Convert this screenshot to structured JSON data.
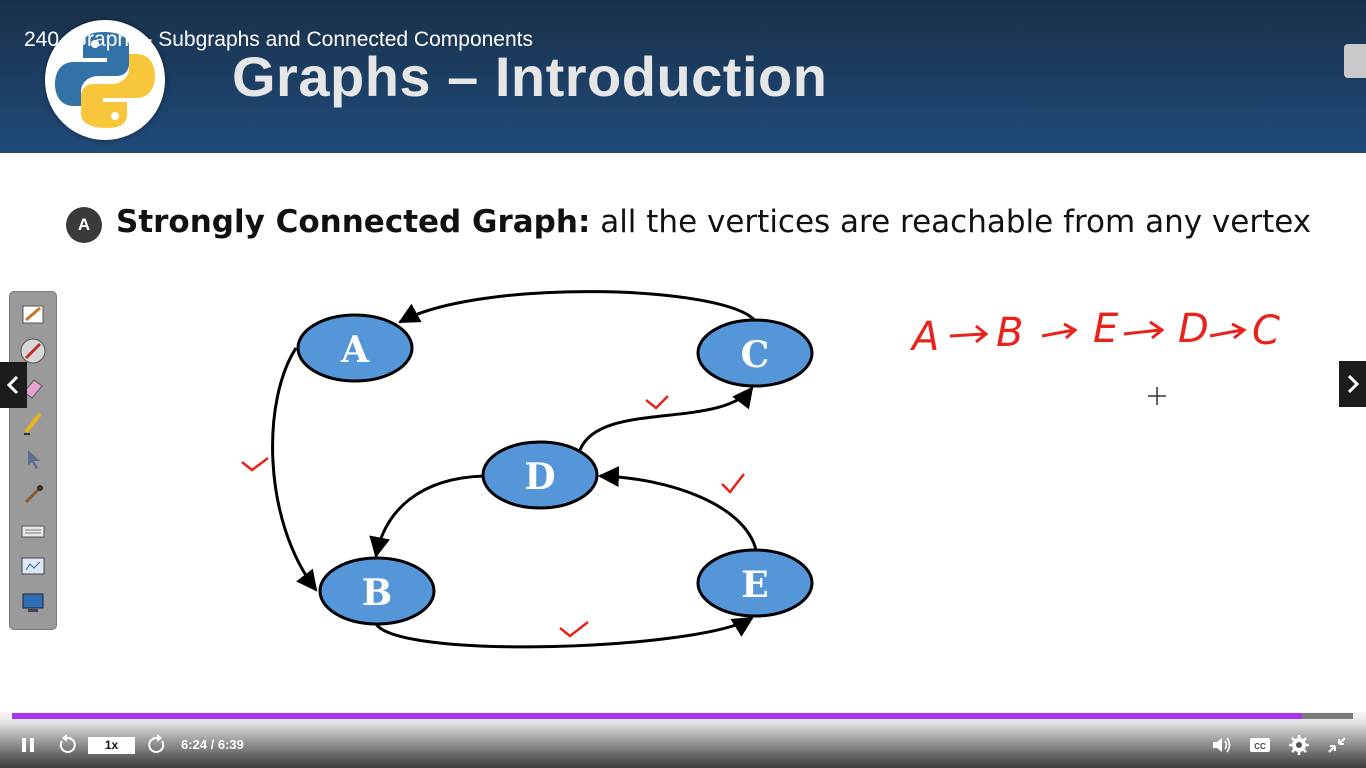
{
  "video": {
    "title": "240. Graphs - Subgraphs and Connected Components"
  },
  "slide": {
    "title": "Graphs – Introduction",
    "bullet_marker": "A",
    "definition_term": "Strongly Connected Graph:",
    "definition_text": " all the vertices are reachable from any vertex"
  },
  "graph": {
    "nodes": [
      "A",
      "C",
      "D",
      "B",
      "E"
    ],
    "node_color": "#5596d8",
    "edges": [
      [
        "C",
        "A"
      ],
      [
        "A",
        "B"
      ],
      [
        "B",
        "E"
      ],
      [
        "E",
        "D"
      ],
      [
        "D",
        "B"
      ],
      [
        "D",
        "C"
      ]
    ]
  },
  "annotation": {
    "path": [
      "A",
      "B",
      "E",
      "D",
      "C"
    ],
    "color": "#e8231c"
  },
  "toolbar": {
    "tools": [
      "pen-settings-icon",
      "laser-pointer-icon",
      "eraser-icon",
      "highlighter-icon",
      "cursor-icon",
      "brush-icon",
      "keyboard-icon",
      "whiteboard-icon",
      "screen-icon"
    ]
  },
  "player": {
    "speed": "1x",
    "time": "6:24 / 6:39",
    "progress": 0.962,
    "accent": "#a435f0"
  }
}
